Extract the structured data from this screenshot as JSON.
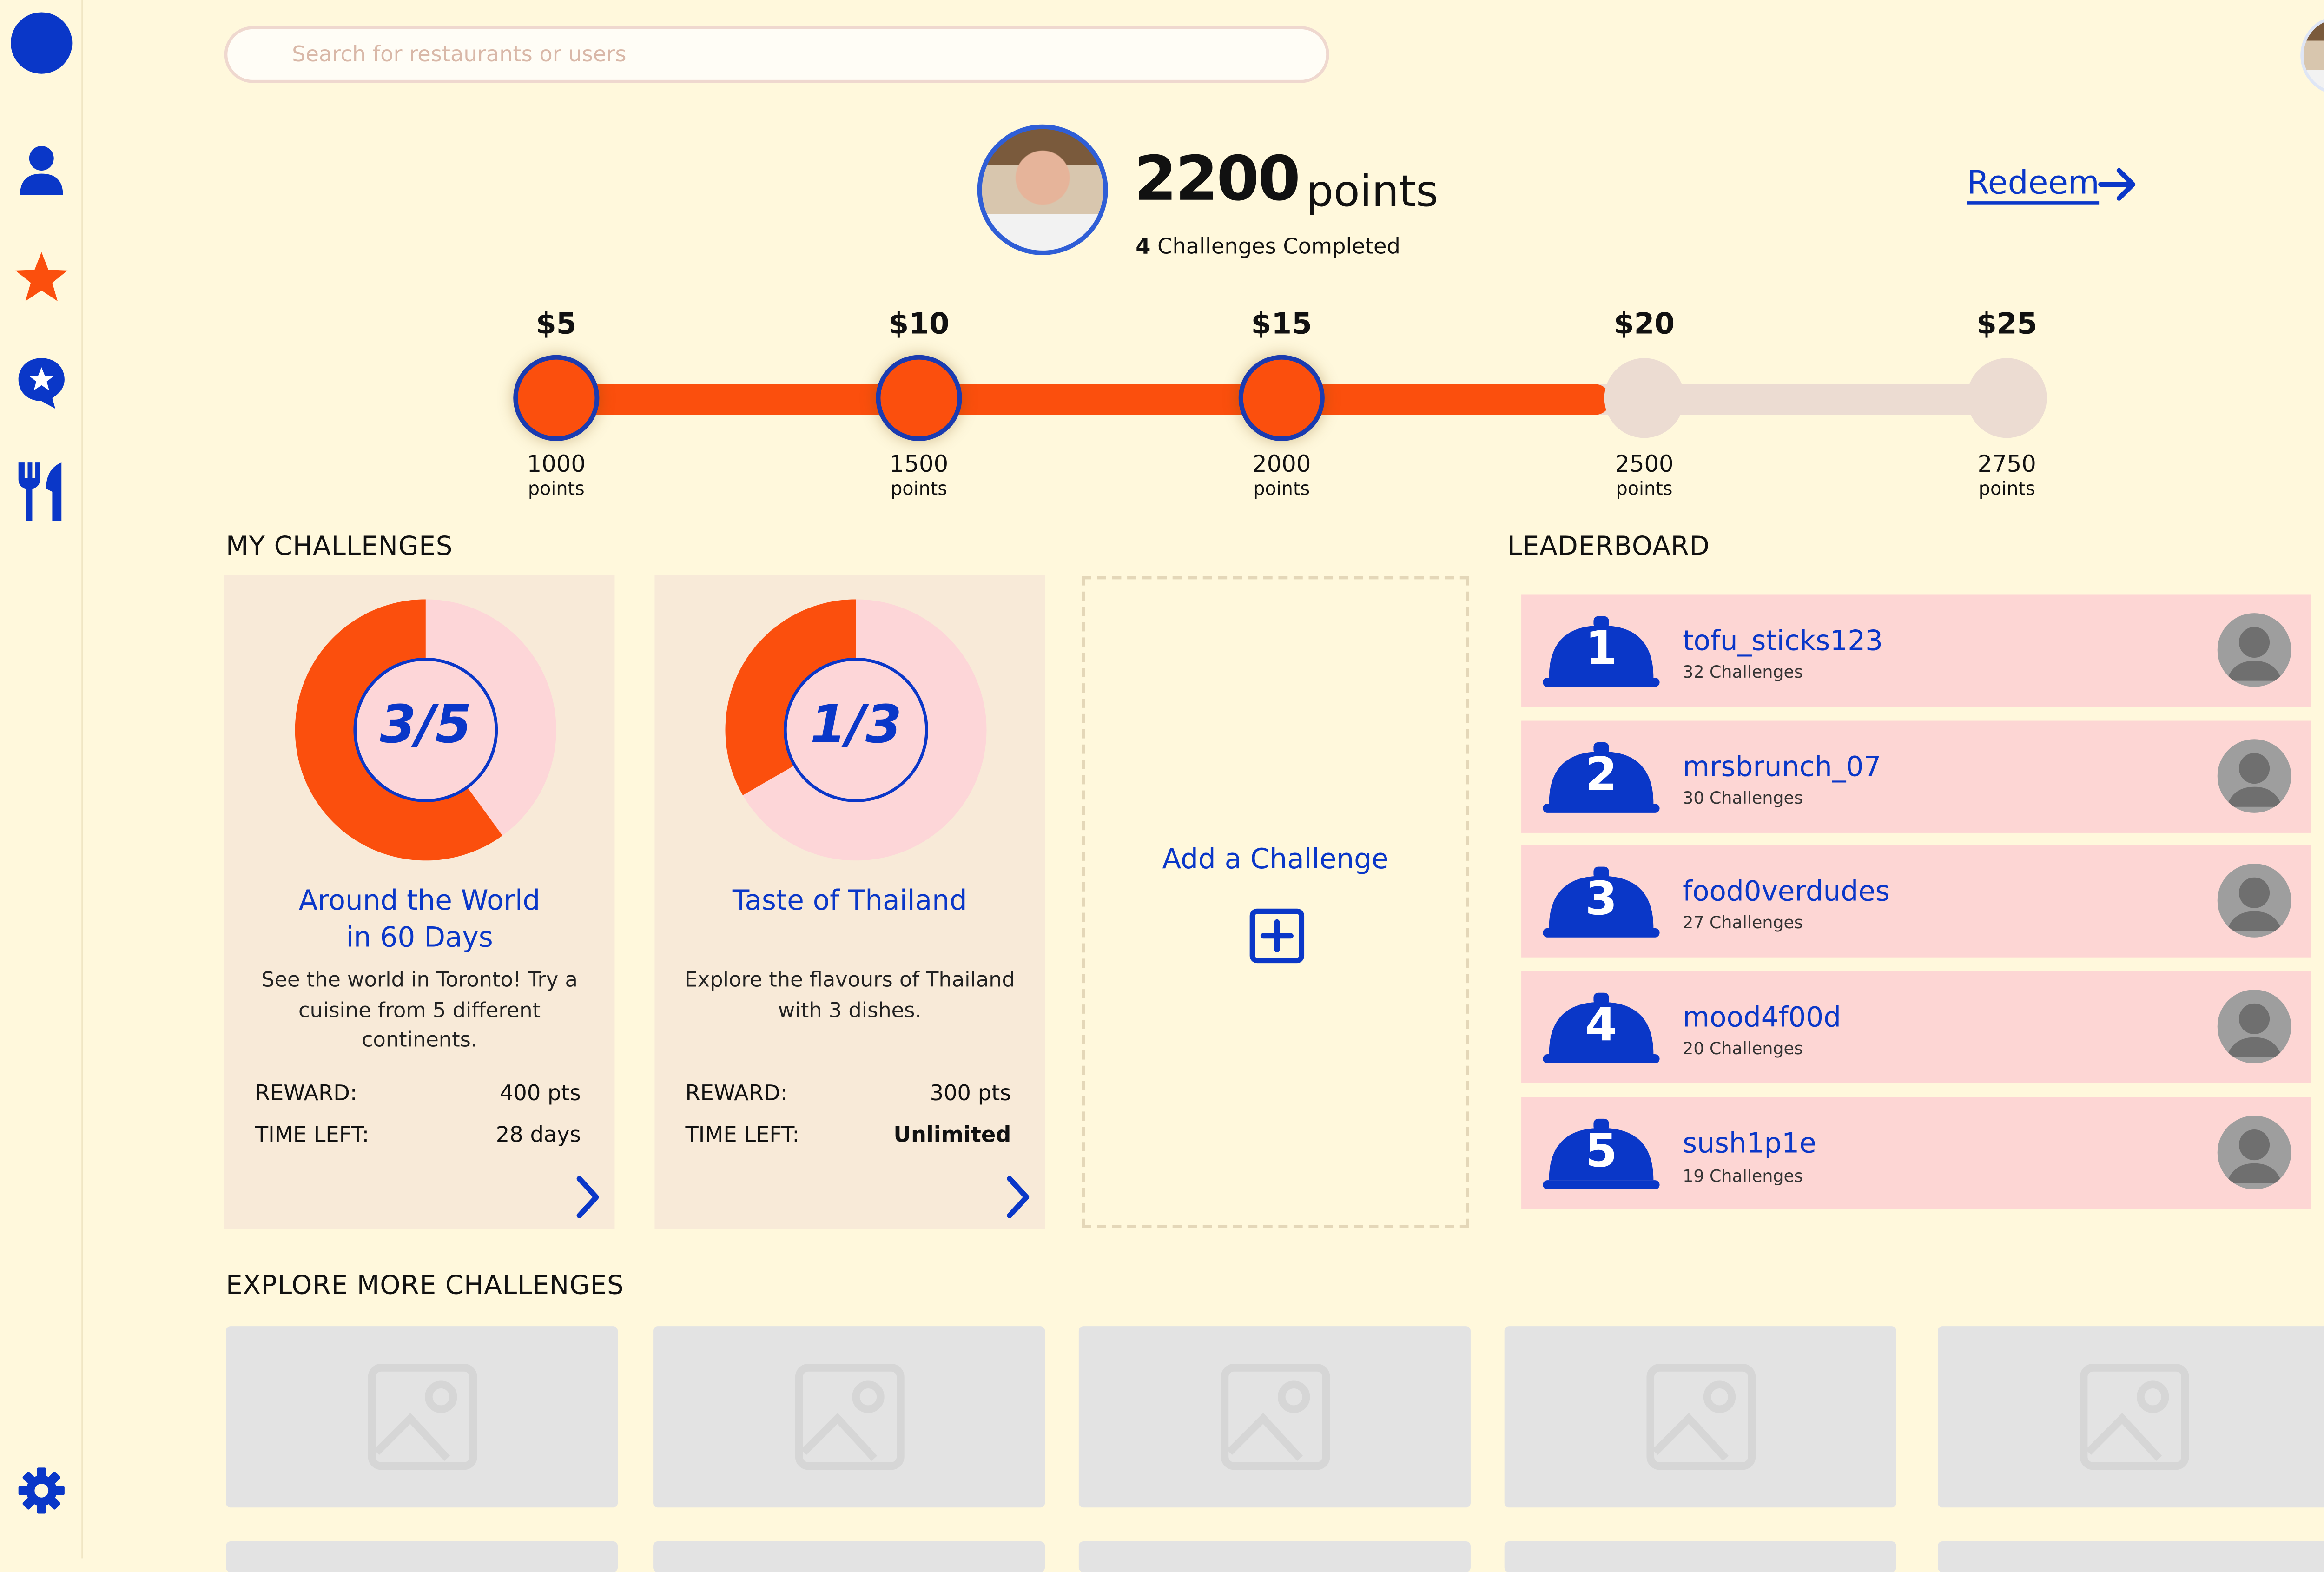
{
  "sidebar": {
    "items": [
      {
        "icon": "profile-icon"
      },
      {
        "icon": "star-icon"
      },
      {
        "icon": "review-star-icon"
      },
      {
        "icon": "restaurant-icon"
      }
    ],
    "settings_icon": "gear-icon"
  },
  "search": {
    "placeholder": "Search for restaurants or users"
  },
  "profile": {
    "points": "2200",
    "points_word": "points",
    "completed_count": "4",
    "completed_label": "Challenges Completed",
    "redeem_label": "Redeem"
  },
  "rewards": {
    "progress_points": 2200,
    "milestones": [
      {
        "price": "$5",
        "points": "1000",
        "unit": "points",
        "reached": true
      },
      {
        "price": "$10",
        "points": "1500",
        "unit": "points",
        "reached": true
      },
      {
        "price": "$15",
        "points": "2000",
        "unit": "points",
        "reached": true
      },
      {
        "price": "$20",
        "points": "2500",
        "unit": "points",
        "reached": false
      },
      {
        "price": "$25",
        "points": "2750",
        "unit": "points",
        "reached": false
      }
    ]
  },
  "my_challenges": {
    "title": "MY CHALLENGES",
    "cards": [
      {
        "progress": "3/5",
        "fraction": 0.6,
        "title_line1": "Around the World",
        "title_line2": "in 60 Days",
        "desc_line1": "See the world in Toronto! Try a",
        "desc_line2": "cuisine from 5 different",
        "desc_line3": "continents.",
        "reward_label": "REWARD:",
        "reward_value": "400",
        "reward_unit": "pts",
        "time_label": "TIME LEFT:",
        "time_value": "28",
        "time_unit": "days"
      },
      {
        "progress": "1/3",
        "fraction": 0.3333,
        "title_line1": "Taste of Thailand",
        "desc_line1": "Explore the flavours of Thailand",
        "desc_line2": "with 3 dishes.",
        "reward_label": "REWARD:",
        "reward_value": "300",
        "reward_unit": "pts",
        "time_label": "TIME LEFT:",
        "time_value": "Unlimited"
      }
    ],
    "add_label": "Add a Challenge"
  },
  "leaderboard": {
    "title": "LEADERBOARD",
    "rows": [
      {
        "rank": "1",
        "name": "tofu_sticks123",
        "sub": "32 Challenges"
      },
      {
        "rank": "2",
        "name": "mrsbrunch_07",
        "sub": "30 Challenges"
      },
      {
        "rank": "3",
        "name": "food0verdudes",
        "sub": "27 Challenges"
      },
      {
        "rank": "4",
        "name": "mood4f00d",
        "sub": "20 Challenges"
      },
      {
        "rank": "5",
        "name": "sush1p1e",
        "sub": "19 Challenges"
      }
    ]
  },
  "explore": {
    "title": "EXPLORE  MORE CHALLENGES"
  },
  "colors": {
    "background": "#fff8dc",
    "accent_blue": "#0a37c8",
    "accent_orange": "#fb4f0d",
    "card": "#f8ead8",
    "leaderboard_row": "#fdd6d4"
  }
}
